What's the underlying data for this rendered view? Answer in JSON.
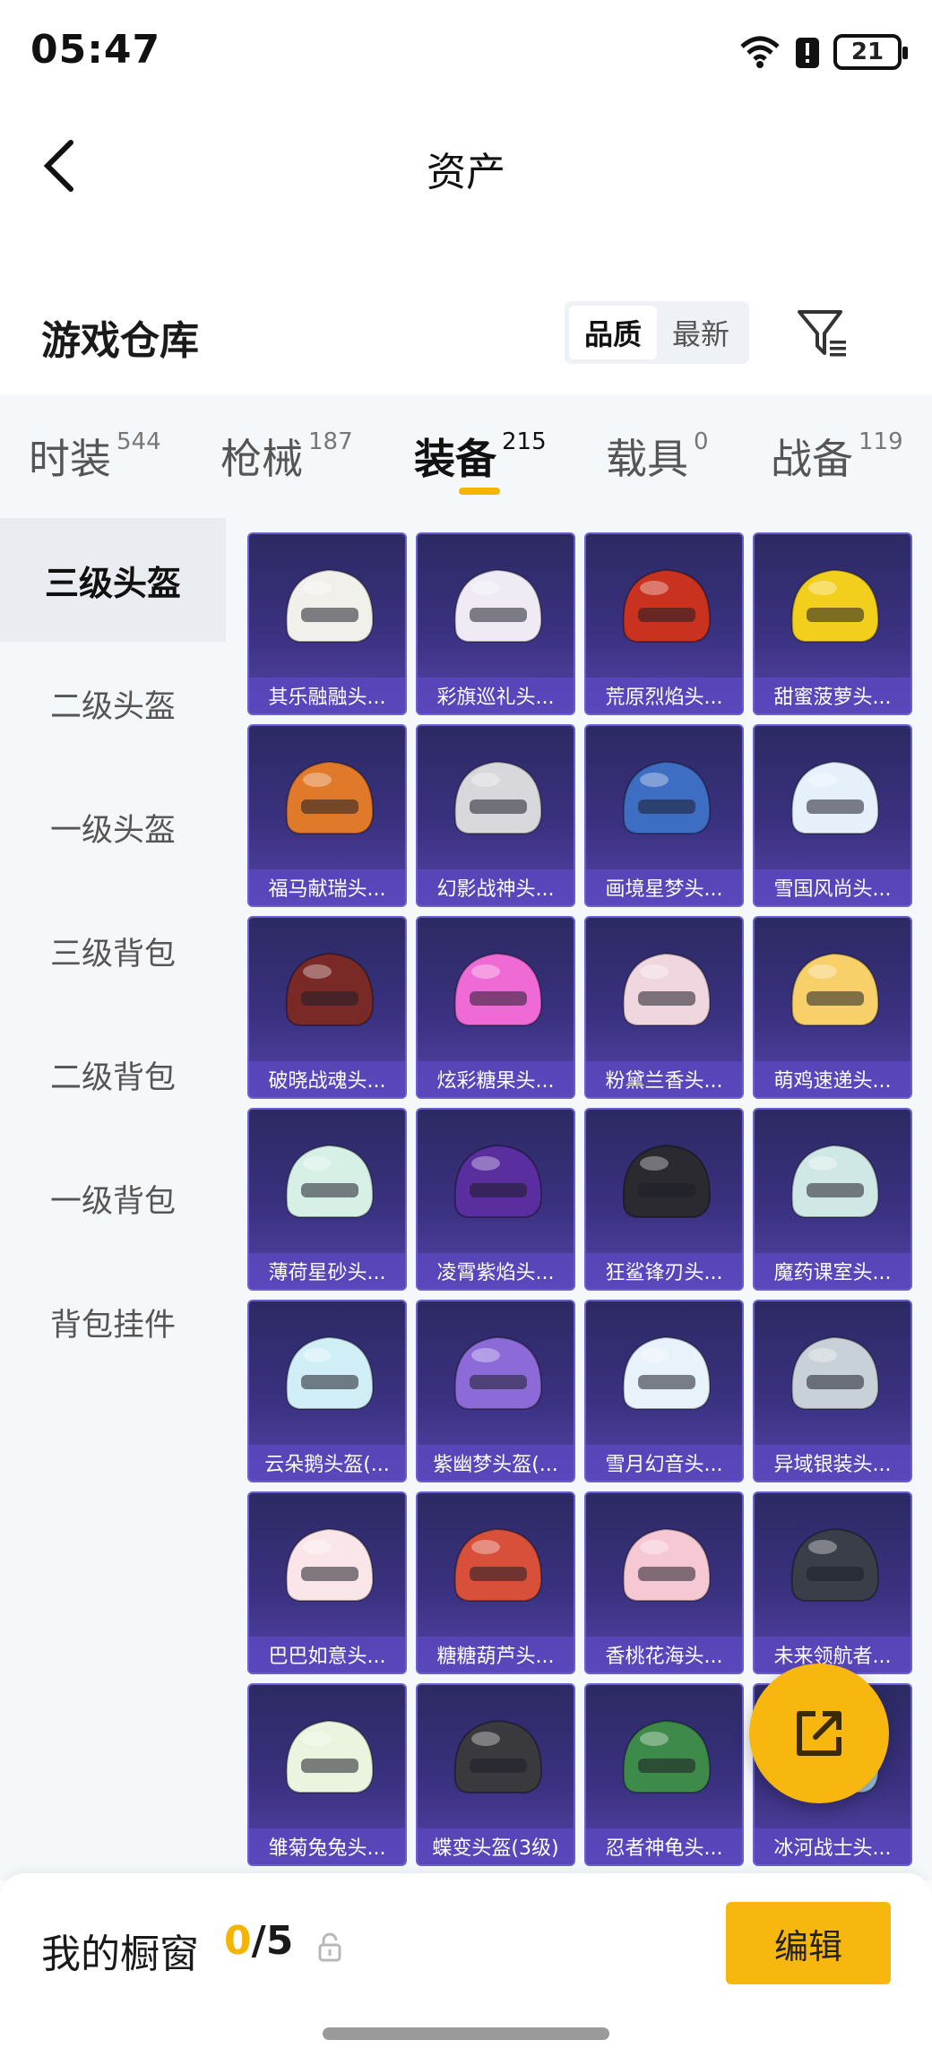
{
  "status_bar": {
    "time": "05:47",
    "battery": "21"
  },
  "nav": {
    "title": "资产"
  },
  "warehouse": {
    "title": "游戏仓库",
    "sort_options": [
      {
        "label": "品质",
        "active": true
      },
      {
        "label": "最新",
        "active": false
      }
    ]
  },
  "category_tabs": [
    {
      "label": "时装",
      "count": "544",
      "active": false
    },
    {
      "label": "枪械",
      "count": "187",
      "active": false
    },
    {
      "label": "装备",
      "count": "215",
      "active": true
    },
    {
      "label": "载具",
      "count": "0",
      "active": false
    },
    {
      "label": "战备",
      "count": "119",
      "active": false
    }
  ],
  "sidebar": [
    {
      "label": "三级头盔",
      "active": true
    },
    {
      "label": "二级头盔",
      "active": false
    },
    {
      "label": "一级头盔",
      "active": false
    },
    {
      "label": "三级背包",
      "active": false
    },
    {
      "label": "二级背包",
      "active": false
    },
    {
      "label": "一级背包",
      "active": false
    },
    {
      "label": "背包挂件",
      "active": false
    }
  ],
  "items": [
    {
      "name": "其乐融融头...",
      "color": "#f2f0ea"
    },
    {
      "name": "彩旗巡礼头...",
      "color": "#f0eaf4"
    },
    {
      "name": "荒原烈焰头...",
      "color": "#c8321e"
    },
    {
      "name": "甜蜜菠萝头...",
      "color": "#f2cf1c"
    },
    {
      "name": "福马献瑞头...",
      "color": "#e07a2a"
    },
    {
      "name": "幻影战神头...",
      "color": "#d8d8dc"
    },
    {
      "name": "画境星梦头...",
      "color": "#3e6ec4"
    },
    {
      "name": "雪国风尚头...",
      "color": "#e6f0fa"
    },
    {
      "name": "破晓战魂头...",
      "color": "#7a2a26"
    },
    {
      "name": "炫彩糖果头...",
      "color": "#f06ad6"
    },
    {
      "name": "粉黛兰香头...",
      "color": "#f0d6de"
    },
    {
      "name": "萌鸡速递头...",
      "color": "#f8d06a"
    },
    {
      "name": "薄荷星砂头...",
      "color": "#d6f0e6"
    },
    {
      "name": "凌霄紫焰头...",
      "color": "#5a2e9e"
    },
    {
      "name": "狂鲨锋刃头...",
      "color": "#2a2a30"
    },
    {
      "name": "魔药课室头...",
      "color": "#cfe8e6"
    },
    {
      "name": "云朵鹅头盔(...",
      "color": "#cfeef6"
    },
    {
      "name": "紫幽梦头盔(...",
      "color": "#8c6ad8"
    },
    {
      "name": "雪月幻音头...",
      "color": "#e8f2fa"
    },
    {
      "name": "异域银装头...",
      "color": "#c8d0d8"
    },
    {
      "name": "巴巴如意头...",
      "color": "#fae6e8"
    },
    {
      "name": "糖糖葫芦头...",
      "color": "#d8503a"
    },
    {
      "name": "香桃花海头...",
      "color": "#f6c8d4"
    },
    {
      "name": "未来领航者...",
      "color": "#3a3e48"
    },
    {
      "name": "雏菊兔兔头...",
      "color": "#eaf4de"
    },
    {
      "name": "蝶变头盔(3级)",
      "color": "#3a3a3e"
    },
    {
      "name": "忍者神龟头...",
      "color": "#3e8a4a"
    },
    {
      "name": "冰河战士头...",
      "color": "#9ec6e6"
    }
  ],
  "showcase": {
    "title": "我的橱窗",
    "current": "0",
    "separator": "/",
    "total": "5",
    "edit_label": "编辑"
  },
  "colors": {
    "accent": "#f8b70f",
    "card_bg": "#3a3180",
    "sidebar_bg": "#f5f8fb"
  }
}
